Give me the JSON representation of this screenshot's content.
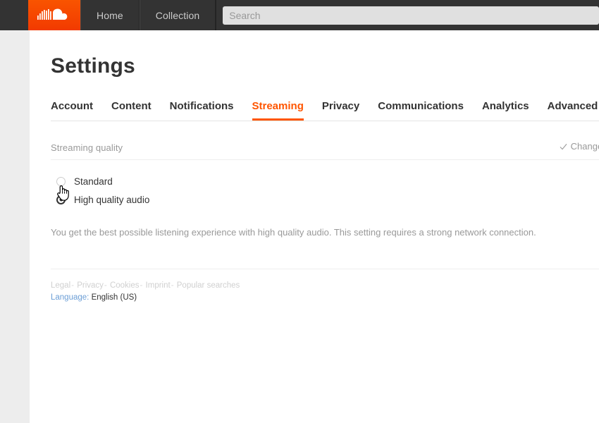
{
  "header": {
    "logo_name": "soundcloud-logo",
    "nav": [
      {
        "label": "Home",
        "name": "nav-home"
      },
      {
        "label": "Collection",
        "name": "nav-collection"
      }
    ],
    "search": {
      "placeholder": "Search",
      "value": ""
    }
  },
  "page": {
    "title": "Settings",
    "tabs": [
      {
        "label": "Account",
        "active": false
      },
      {
        "label": "Content",
        "active": false
      },
      {
        "label": "Notifications",
        "active": false
      },
      {
        "label": "Streaming",
        "active": true
      },
      {
        "label": "Privacy",
        "active": false
      },
      {
        "label": "Communications",
        "active": false
      },
      {
        "label": "Analytics",
        "active": false
      },
      {
        "label": "Advanced",
        "active": false
      }
    ],
    "section": {
      "title": "Streaming quality",
      "saved_note": "Changes saved"
    },
    "options": [
      {
        "label": "Standard",
        "selected": false
      },
      {
        "label": "High quality audio",
        "selected": true
      }
    ],
    "description": "You get the best possible listening experience with high quality audio. This setting requires a strong network connection.",
    "footer": {
      "links": [
        "Legal",
        "Privacy",
        "Cookies",
        "Imprint",
        "Popular searches"
      ],
      "separator": "-",
      "language_label": "Language:",
      "language_value": "English (US)"
    }
  },
  "colors": {
    "accent": "#ff5500",
    "header_bg": "#333333",
    "rail_bg": "#ededed",
    "link_blue": "#6b9ed6"
  }
}
